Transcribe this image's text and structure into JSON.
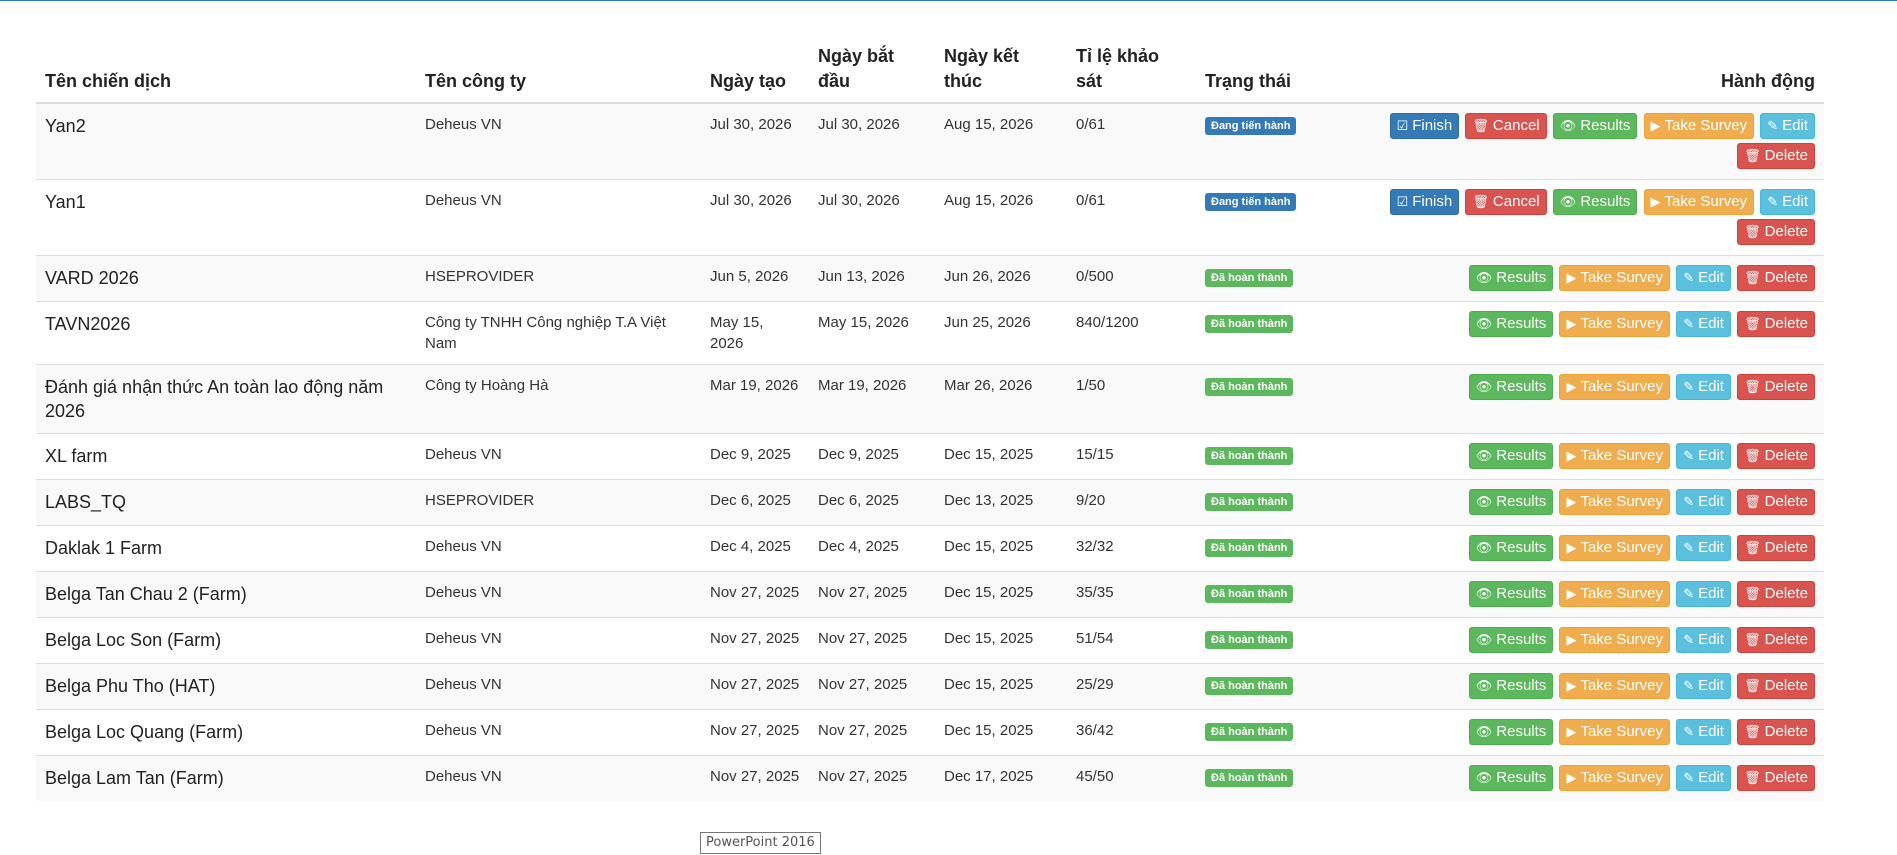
{
  "colors": {
    "status_inprogress": "#337ab7",
    "status_done": "#5cb85c",
    "finish": "#337ab7",
    "cancel": "#d9534f",
    "results": "#5cb85c",
    "take_survey": "#f0ad4e",
    "edit": "#5bc0de",
    "delete": "#d9534f"
  },
  "table": {
    "headers": [
      "Tên chiến dịch",
      "Tên công ty",
      "Ngày tạo",
      "Ngày bắt đầu",
      "Ngày kết thúc",
      "Tỉ lệ khảo sát",
      "Trạng thái",
      "Hành động"
    ],
    "rows": [
      {
        "name": "Yan2",
        "company": "Deheus VN",
        "created": "Jul 30, 2026",
        "start": "Jul 30, 2026",
        "end": "Aug 15, 2026",
        "ratio": "0/61",
        "status": "Đang tiến hành",
        "status_type": "inprogress"
      },
      {
        "name": "Yan1",
        "company": "Deheus VN",
        "created": "Jul 30, 2026",
        "start": "Jul 30, 2026",
        "end": "Aug 15, 2026",
        "ratio": "0/61",
        "status": "Đang tiến hành",
        "status_type": "inprogress"
      },
      {
        "name": "VARD 2026",
        "company": "HSEPROVIDER",
        "created": "Jun 5, 2026",
        "start": "Jun 13, 2026",
        "end": "Jun 26, 2026",
        "ratio": "0/500",
        "status": "Đã hoàn thành",
        "status_type": "done"
      },
      {
        "name": "TAVN2026",
        "company": "Công ty TNHH Công nghiệp T.A Việt Nam",
        "created": "May 15, 2026",
        "start": "May 15, 2026",
        "end": "Jun 25, 2026",
        "ratio": "840/1200",
        "status": "Đã hoàn thành",
        "status_type": "done"
      },
      {
        "name": "Đánh giá nhận thức An toàn lao động năm 2026",
        "company": "Công ty Hoàng Hà",
        "created": "Mar 19, 2026",
        "start": "Mar 19, 2026",
        "end": "Mar 26, 2026",
        "ratio": "1/50",
        "status": "Đã hoàn thành",
        "status_type": "done"
      },
      {
        "name": "XL farm",
        "company": "Deheus VN",
        "created": "Dec 9, 2025",
        "start": "Dec 9, 2025",
        "end": "Dec 15, 2025",
        "ratio": "15/15",
        "status": "Đã hoàn thành",
        "status_type": "done"
      },
      {
        "name": "LABS_TQ",
        "company": "HSEPROVIDER",
        "created": "Dec 6, 2025",
        "start": "Dec 6, 2025",
        "end": "Dec 13, 2025",
        "ratio": "9/20",
        "status": "Đã hoàn thành",
        "status_type": "done"
      },
      {
        "name": "Daklak 1 Farm",
        "company": "Deheus VN",
        "created": "Dec 4, 2025",
        "start": "Dec 4, 2025",
        "end": "Dec 15, 2025",
        "ratio": "32/32",
        "status": "Đã hoàn thành",
        "status_type": "done"
      },
      {
        "name": "Belga Tan Chau 2 (Farm)",
        "company": "Deheus VN",
        "created": "Nov 27, 2025",
        "start": "Nov 27, 2025",
        "end": "Dec 15, 2025",
        "ratio": "35/35",
        "status": "Đã hoàn thành",
        "status_type": "done"
      },
      {
        "name": "Belga Loc Son (Farm)",
        "company": "Deheus VN",
        "created": "Nov 27, 2025",
        "start": "Nov 27, 2025",
        "end": "Dec 15, 2025",
        "ratio": "51/54",
        "status": "Đã hoàn thành",
        "status_type": "done"
      },
      {
        "name": "Belga Phu Tho (HAT)",
        "company": "Deheus VN",
        "created": "Nov 27, 2025",
        "start": "Nov 27, 2025",
        "end": "Dec 15, 2025",
        "ratio": "25/29",
        "status": "Đã hoàn thành",
        "status_type": "done"
      },
      {
        "name": "Belga Loc Quang (Farm)",
        "company": "Deheus VN",
        "created": "Nov 27, 2025",
        "start": "Nov 27, 2025",
        "end": "Dec 15, 2025",
        "ratio": "36/42",
        "status": "Đã hoàn thành",
        "status_type": "done"
      },
      {
        "name": "Belga Lam Tan (Farm)",
        "company": "Deheus VN",
        "created": "Nov 27, 2025",
        "start": "Nov 27, 2025",
        "end": "Dec 17, 2025",
        "ratio": "45/50",
        "status": "Đã hoàn thành",
        "status_type": "done"
      }
    ]
  },
  "actions": {
    "finish": "Finish",
    "cancel": "Cancel",
    "results": "Results",
    "take_survey": "Take Survey",
    "edit": "Edit",
    "delete": "Delete"
  },
  "icons": {
    "finish": "check-square-icon",
    "cancel": "trash-icon",
    "results": "eye-icon",
    "take_survey": "play-icon",
    "edit": "edit-icon",
    "delete": "trash-icon"
  },
  "tooltip": "PowerPoint 2016"
}
